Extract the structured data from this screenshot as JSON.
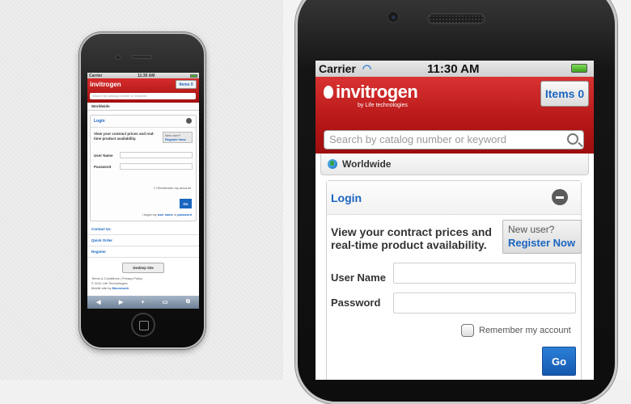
{
  "status": {
    "carrier": "Carrier",
    "time": "11:30 AM"
  },
  "header": {
    "logo": "invitrogen",
    "logo_sub": "by Life technologies",
    "items_button": "Items 0",
    "search_placeholder": "Search by catalog number or keyword"
  },
  "region": {
    "label": "Worldwide"
  },
  "login": {
    "title": "Login",
    "promo": "View your contract prices and real-time product availability.",
    "new_user": "New user?",
    "register_now": "Register Now",
    "username_label": "User Name",
    "password_label": "Password",
    "remember_label": "Remember my account",
    "go_button": "Go",
    "forgot_prefix": "I forgot my",
    "forgot_username": "user name",
    "forgot_or": "or",
    "forgot_password": "password"
  },
  "links": [
    "Contact Us",
    "Quick Order",
    "Register"
  ],
  "desktop_site": "Desktop Site",
  "footer": {
    "terms": "Terms & Conditions | Privacy Policy",
    "copyright": "© 2011 Life Technologies",
    "mobile_by": "Mobile site by",
    "mobile_vendor": "Mooveweb"
  },
  "toolbar": [
    "◀",
    "▶",
    "+",
    "▭",
    "⧉"
  ],
  "colors": {
    "brand_red": "#c62020",
    "link_blue": "#1a65c0"
  }
}
